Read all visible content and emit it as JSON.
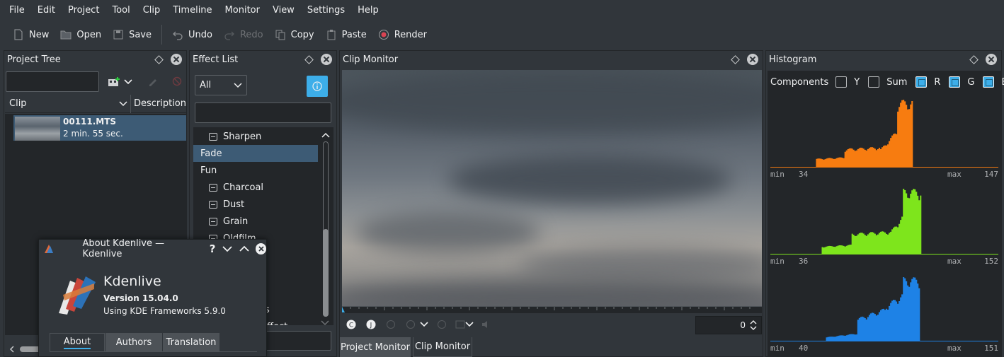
{
  "menubar": [
    "File",
    "Edit",
    "Project",
    "Tool",
    "Clip",
    "Timeline",
    "Monitor",
    "View",
    "Settings",
    "Help"
  ],
  "toolbar": {
    "new": "New",
    "open": "Open",
    "save": "Save",
    "undo": "Undo",
    "redo": "Redo",
    "copy": "Copy",
    "paste": "Paste",
    "render": "Render"
  },
  "project_tree": {
    "title": "Project Tree",
    "search_value": "",
    "columns": [
      "Clip",
      "Description"
    ],
    "clip": {
      "name": "00111.MTS",
      "duration": "2 min. 55 sec."
    }
  },
  "effect_list": {
    "title": "Effect List",
    "filter": "All",
    "search_value": "",
    "items": [
      {
        "label": "Sharpen",
        "icon": true,
        "indent": true,
        "selected": false
      },
      {
        "label": "Fade",
        "icon": false,
        "indent": false,
        "selected": true
      },
      {
        "label": "Fun",
        "icon": false,
        "indent": false,
        "selected": false
      },
      {
        "label": "Charcoal",
        "icon": true,
        "indent": true,
        "selected": false
      },
      {
        "label": "Dust",
        "icon": true,
        "indent": true,
        "selected": false
      },
      {
        "label": "Grain",
        "icon": true,
        "indent": true,
        "selected": false
      },
      {
        "label": "Oldfilm",
        "icon": true,
        "indent": true,
        "selected": false
      }
    ],
    "partial_texts": [
      "es",
      "ffect"
    ]
  },
  "clip_monitor": {
    "title": "Clip Monitor",
    "timecode": "0",
    "tabs": [
      "Project Monitor",
      "Clip Monitor"
    ]
  },
  "histogram": {
    "title": "Histogram",
    "components_label": "Components",
    "components": [
      {
        "label": "Y",
        "checked": false
      },
      {
        "label": "Sum",
        "checked": false
      },
      {
        "label": "R",
        "checked": true
      },
      {
        "label": "G",
        "checked": true
      },
      {
        "label": "B",
        "checked": true
      }
    ],
    "channels": [
      {
        "name": "R",
        "color": "#f77c10",
        "min": "34",
        "max": "147"
      },
      {
        "name": "G",
        "color": "#7ee51c",
        "min": "36",
        "max": "152"
      },
      {
        "name": "B",
        "color": "#1e82e6",
        "min": "40",
        "max": "151"
      }
    ],
    "min_label": "min",
    "max_label": "max"
  },
  "about_dialog": {
    "title": "About Kdenlive — Kdenlive",
    "app_name": "Kdenlive",
    "version": "Version 15.04.0",
    "frameworks": "Using KDE Frameworks 5.9.0",
    "tabs": [
      "About",
      "Authors",
      "Translation"
    ]
  },
  "colors": {
    "selection": "#3d5b75",
    "accent": "#3daee9",
    "background": "#31363b",
    "dark": "#232629"
  }
}
